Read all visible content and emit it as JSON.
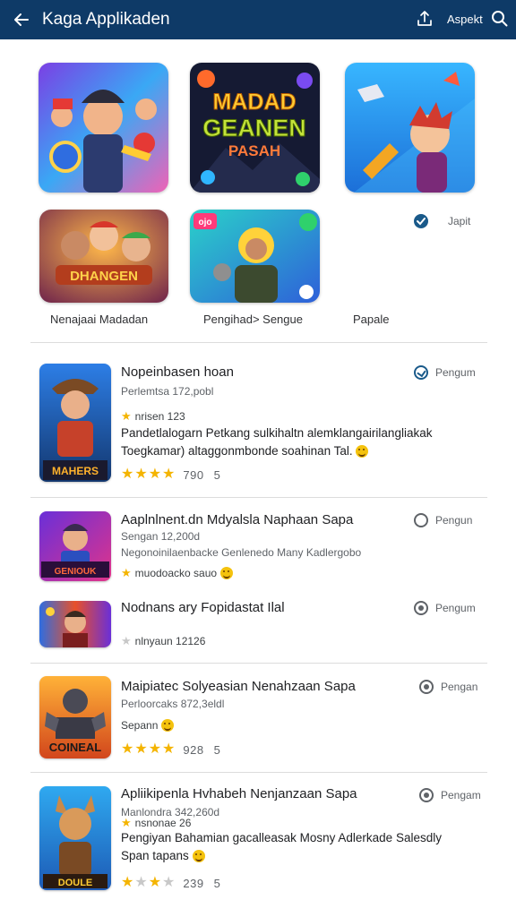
{
  "appbar": {
    "title": "Kaga Applikaden",
    "aspect_label": "Aspekt",
    "icons": [
      "back-arrow-icon",
      "share-icon",
      "search-icon"
    ],
    "background": "#0e3a67"
  },
  "featured_grid": {
    "tiles": [
      {
        "art": "heroes-group-art"
      },
      {
        "art": "title-card-art",
        "art_text_1": "MADAD",
        "art_text_2": "GEANEN",
        "art_text_3": "PASAH"
      },
      {
        "art": "rocket-hero-art"
      },
      {
        "art": "adventurers-art",
        "art_text": "DHANGEN"
      },
      {
        "art": "green-robot-art",
        "badge_text": "ojo"
      }
    ],
    "labels": [
      "Nenajaai  Madadan",
      "Pengihad> Sengue",
      "Papale"
    ],
    "side_badge_label": "Japit"
  },
  "list": {
    "items": [
      {
        "title": "Nopeinbasen hoan",
        "subtitle": "Perlemtsa 172,pobl",
        "meta": "nrisen 123",
        "description": "Pandetlalogarn Petkang sulkihaltn alemklangairilangliakak Toegkamar) altaggonmbonde soahinan Tal.",
        "stars": [
          1,
          1,
          1,
          1,
          0.5
        ],
        "rating_value": "790",
        "rating_extra": "5",
        "action_label": "Pengum",
        "action_state": "installed",
        "icon_text": "MAHERS"
      },
      {
        "title": "Aaplnlnent.dn Mdyalsla Naphaan Sapa",
        "subtitle": "Sengan 12,200d",
        "meta_line": "Negonoinilaenbacke Genlenedo Many Kadlergobo",
        "meta": "muodoacko sauo",
        "action_label": "Pengun",
        "action_state": "available",
        "icon_text": "GENIOUK"
      },
      {
        "title": "Nodnans ary Fopidastat Ilal",
        "meta": "nlnyaun 12126",
        "action_label": "Pengum",
        "action_state": "available"
      },
      {
        "title": "Maipiatec Solyeasian Nenahzaan Sapa",
        "subtitle": "Perloorcaks 872,3eldl",
        "meta": "Sepann",
        "stars": [
          1,
          1,
          1,
          0.5,
          0
        ],
        "rating_value": "928",
        "rating_extra": "5",
        "action_label": "Pengan",
        "action_state": "available",
        "icon_text": "COINEAL"
      },
      {
        "title": "Apliikipenla Hvhabeh Nenjanzaan Sapa",
        "subtitle": "Manlondra 342,260d",
        "meta": "nsnonae 26",
        "description": "Pengiyan  Bahamian gacalleasak Mosny Adlerkade Salesdly  Span tapans",
        "stars": [
          1,
          0,
          0.5,
          0,
          0
        ],
        "rating_value": "239",
        "rating_extra": "5",
        "action_label": "Pengam",
        "action_state": "available",
        "icon_text": "DOULE"
      }
    ]
  },
  "colors": {
    "star": "#f4b400",
    "accent": "#1a5a8a"
  }
}
